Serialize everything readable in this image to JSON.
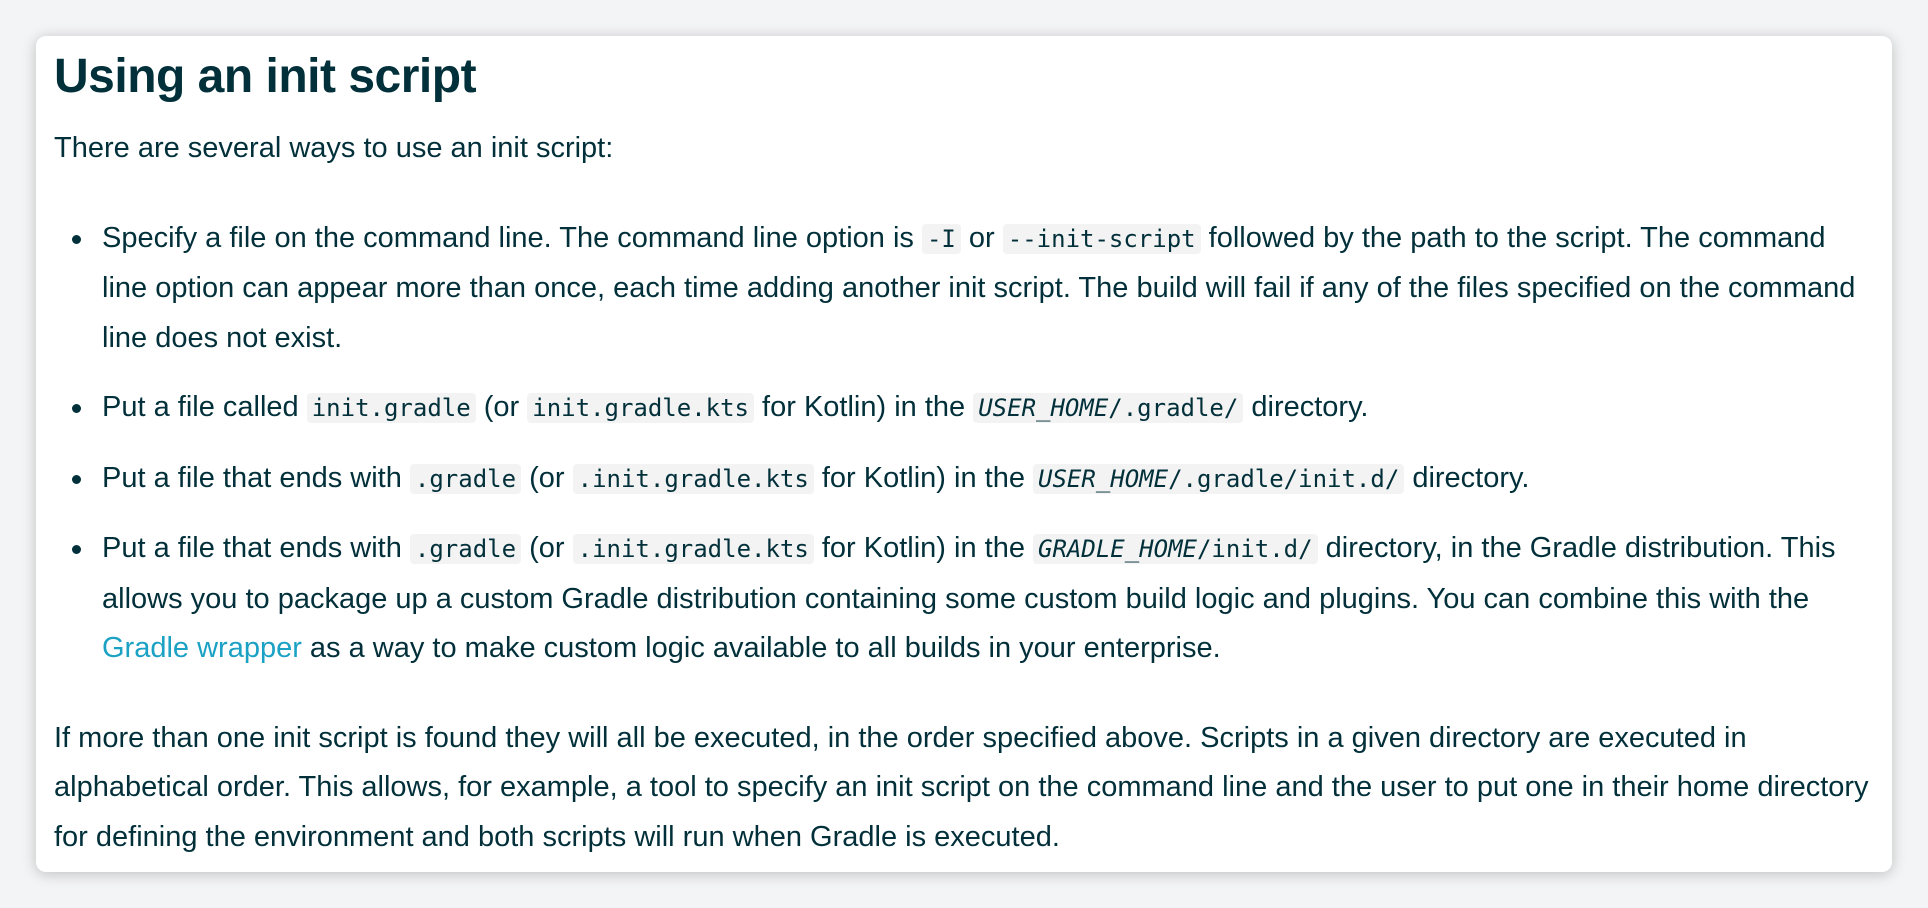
{
  "heading": "Using an init script",
  "intro": "There are several ways to use an init script:",
  "items": [
    {
      "t1": "Specify a file on the command line. The command line option is ",
      "c1": "-I",
      "t2": " or ",
      "c2": "--init-script",
      "t3": " followed by the path to the script. The command line option can appear more than once, each time adding another init script. The build will fail if any of the files specified on the command line does not exist."
    },
    {
      "t1": "Put a file called ",
      "c1": "init.gradle",
      "t2": " (or ",
      "c2": "init.gradle.kts",
      "t3": " for Kotlin) in the ",
      "c3_em": "USER_HOME",
      "c3": "/.gradle/",
      "t4": " directory."
    },
    {
      "t1": "Put a file that ends with ",
      "c1": ".gradle",
      "t2": " (or ",
      "c2": ".init.gradle.kts",
      "t3": " for Kotlin) in the ",
      "c3_em": "USER_HOME",
      "c3": "/.gradle/init.d/",
      "t4": " directory."
    },
    {
      "t1": "Put a file that ends with ",
      "c1": ".gradle",
      "t2": " (or ",
      "c2": ".init.gradle.kts",
      "t3": " for Kotlin) in the ",
      "c3_em": "GRADLE_HOME",
      "c3": "/init.d/",
      "t4": " directory, in the Gradle distribution. This allows you to package up a custom Gradle distribution containing some custom build logic and plugins. You can combine this with the ",
      "link": "Gradle wrapper",
      "t5": " as a way to make custom logic available to all builds in your enterprise."
    }
  ],
  "outro": "If more than one init script is found they will all be executed, in the order specified above. Scripts in a given directory are executed in alphabetical order. This allows, for example, a tool to specify an init script on the command line and the user to put one in their home directory for defining the environment and both scripts will run when Gradle is executed.",
  "colors": {
    "text": "#02303a",
    "link": "#1ba1c4",
    "code_bg": "#f3f3f3"
  }
}
